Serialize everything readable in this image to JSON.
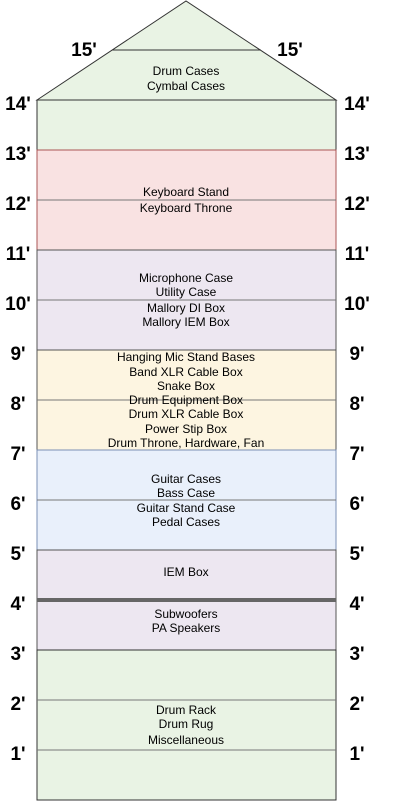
{
  "roof": {
    "label_left": "15'",
    "label_right": "15'",
    "fill": "#e9f3e4",
    "lines": [
      "Drum Cases",
      "Cymbal Cases"
    ]
  },
  "feet_labels": [
    "14'",
    "13'",
    "12'",
    "11'",
    "10'",
    "9'",
    "8'",
    "7'",
    "6'",
    "5'",
    "4'",
    "3'",
    "2'",
    "1'"
  ],
  "zones": [
    {
      "id": "keyboard",
      "fill": "#f9e2e2",
      "lines": [
        "Keyboard Stand",
        "Keyboard Throne"
      ]
    },
    {
      "id": "mic-utility-mallory",
      "fill": "#ede7f1",
      "lines": [
        "Microphone Case",
        "Utility Case",
        "Mallory DI Box",
        "Mallory IEM Box"
      ]
    },
    {
      "id": "drum-equipment",
      "fill": "#fdf5e1",
      "lines": [
        "Hanging Mic Stand Bases",
        "Band XLR Cable Box",
        "Snake Box",
        "Drum Equipment Box",
        "Drum XLR Cable Box",
        "Power Stip Box",
        "Drum Throne, Hardware, Fan"
      ]
    },
    {
      "id": "guitar",
      "fill": "#e9f0fb",
      "lines": [
        "Guitar Cases",
        "Bass Case",
        "Guitar Stand Case",
        "Pedal Cases"
      ]
    },
    {
      "id": "iem",
      "fill": "#ede7f1",
      "lines": [
        "IEM Box"
      ]
    },
    {
      "id": "speakers",
      "fill": "#ede7f1",
      "lines": [
        "Subwoofers",
        "PA Speakers"
      ]
    },
    {
      "id": "drum-rack",
      "fill": "#e9f3e4",
      "lines": [
        "Drum Rack",
        "Drum Rug",
        "Miscellaneous"
      ]
    }
  ]
}
